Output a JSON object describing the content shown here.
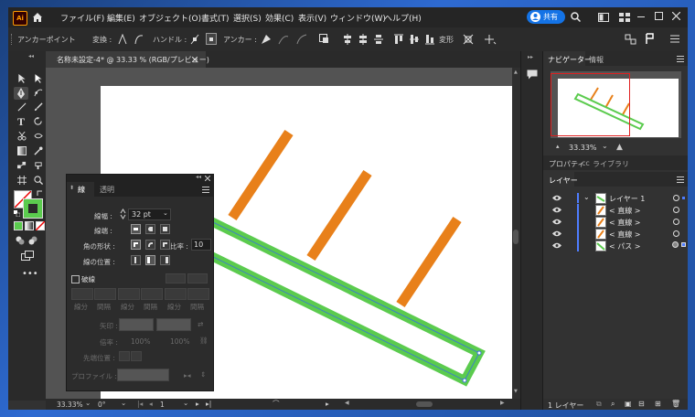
{
  "app": {
    "logo": "Ai"
  },
  "menu": [
    "ファイル(F)",
    "編集(E)",
    "オブジェクト(O)",
    "書式(T)",
    "選択(S)",
    "効果(C)",
    "表示(V)",
    "ウィンドウ(W)",
    "ヘルプ(H)"
  ],
  "share_label": "共有",
  "control": {
    "title": "アンカーポイント",
    "transform": "変換 :",
    "handle": "ハンドル :",
    "anchor": "アンカー :",
    "warp": "変形"
  },
  "document": {
    "tab_title": "名称未設定-4* @ 33.33 % (RGB/プレビュー)"
  },
  "status": {
    "zoom": "33.33%",
    "angle": "0°",
    "artboard": "1"
  },
  "navigator": {
    "tab": "ナビゲーター",
    "info_tab": "情報",
    "zoom": "33.33%"
  },
  "props_tabs": {
    "properties": "プロパティ",
    "libraries": "ライブラリ"
  },
  "layers": {
    "tab": "レイヤー",
    "rows": [
      {
        "name": "レイヤー 1",
        "indent": 0
      },
      {
        "name": "< 直線 >",
        "indent": 1
      },
      {
        "name": "< 直線 >",
        "indent": 1
      },
      {
        "name": "< 直線 >",
        "indent": 1
      },
      {
        "name": "< パス >",
        "indent": 1
      }
    ],
    "footer": "1 レイヤー"
  },
  "stroke_panel": {
    "tab_stroke": "線",
    "tab_transparency": "透明",
    "weight_label": "線幅 :",
    "weight_value": "32 pt",
    "cap_label": "線端 :",
    "corner_label": "角の形状 :",
    "limit_label": "比率 :",
    "limit_value": "10",
    "align_label": "線の位置 :",
    "dashed_label": "破線",
    "dash_labels": [
      "線分",
      "間隔",
      "線分",
      "間隔",
      "線分",
      "間隔"
    ],
    "arrow_label": "矢印 :",
    "scale_label": "倍率 :",
    "scale_values": [
      "100%",
      "100%"
    ],
    "tip_label": "先端位置 :",
    "profile_label": "プロファイル :"
  },
  "colors": {
    "orange": "#E8801A",
    "green": "#5BCB4E",
    "accent": "#1473E6"
  }
}
